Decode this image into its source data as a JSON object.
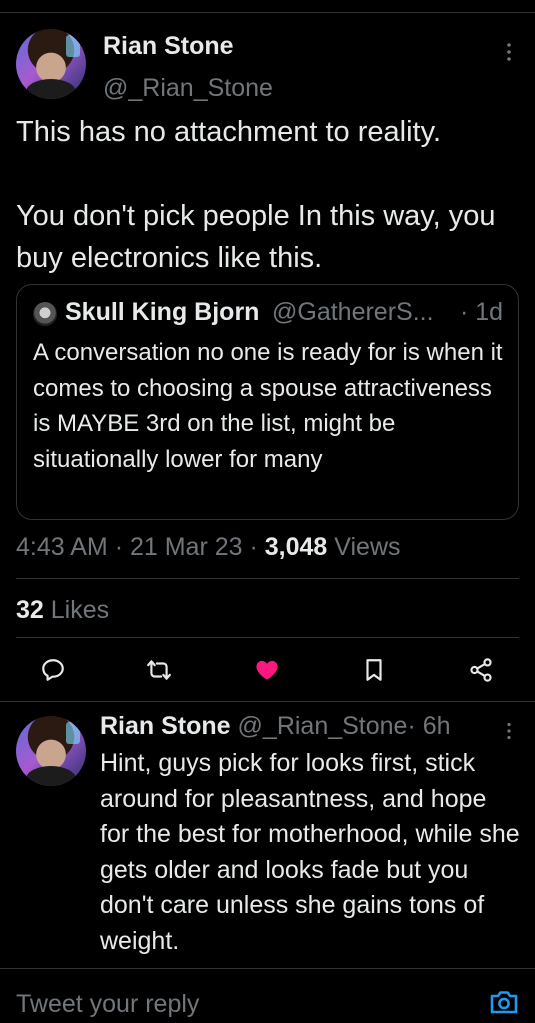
{
  "main_tweet": {
    "author_name": "Rian Stone",
    "author_handle": "@_Rian_Stone",
    "text": "This has no attachment to reality.\n\nYou don't pick people In this way, you buy electronics like this.",
    "quote": {
      "author_name": "Skull King Bjorn",
      "author_handle": "@GathererS...",
      "time": "· 1d",
      "text": "A conversation no one is ready for is when it comes to choosing a spouse attractiveness is MAYBE 3rd on the list, might be situationally lower for many"
    },
    "time": "4:43 AM",
    "date": "21 Mar 23",
    "sep": "·",
    "views_count": "3,048",
    "views_label": "Views",
    "likes_count": "32",
    "likes_label": "Likes"
  },
  "actions": {
    "reply_icon": "reply-icon",
    "retweet_icon": "retweet-icon",
    "like_icon": "heart-icon",
    "bookmark_icon": "bookmark-icon",
    "share_icon": "share-icon",
    "like_color": "#f91880"
  },
  "reply": {
    "author_name": "Rian Stone",
    "author_handle": "@_Rian_Stone",
    "time": "· 6h",
    "text": "Hint, guys pick for looks first, stick around for pleasantness, and hope for the best for motherhood, while she gets older and looks fade but you don't care unless she gains tons of weight."
  },
  "composer": {
    "placeholder": "Tweet your reply",
    "camera_icon": "camera-icon",
    "accent": "#1d9bf0"
  }
}
